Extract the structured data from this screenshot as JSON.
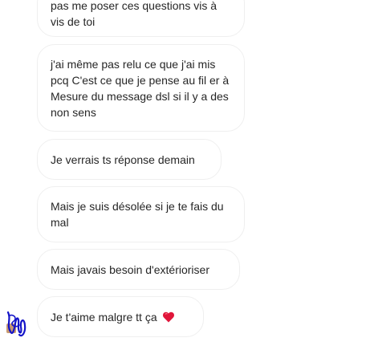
{
  "messages": [
    {
      "text": "pas me poser ces questions vis à vis de toi"
    },
    {
      "text": "j'ai même pas relu ce que j'ai mis pcq C'est ce que je pense au fil er à Mesure du message dsl si il y a des non sens"
    },
    {
      "text": "Je verrais ts réponse demain"
    },
    {
      "text": "Mais je suis désolée si je te fais du mal"
    },
    {
      "text": "Mais javais besoin d'extérioriser"
    },
    {
      "text": "Je t'aime malgre tt ça",
      "emoji": "heart-emoji"
    }
  ],
  "colors": {
    "bubble_border": "#efefef",
    "text": "#262626",
    "heart": "#e0163a",
    "avatar_scribble": "#1414c8"
  },
  "avatar": {
    "icon": "sender-avatar-scribble"
  }
}
